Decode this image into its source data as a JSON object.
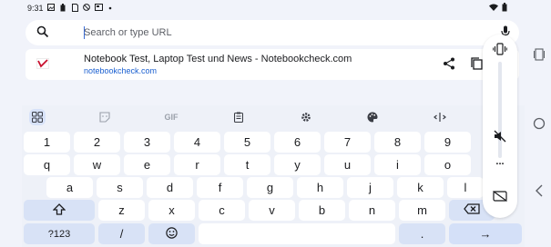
{
  "status_bar": {
    "time": "9:31",
    "left_icons": [
      "image-icon",
      "battery-saver-icon",
      "sim-icon",
      "dnd-icon",
      "screenshot-icon",
      "dot-icon"
    ],
    "right_icons": [
      "wifi-icon",
      "battery-icon"
    ]
  },
  "omnibox": {
    "placeholder": "Search or type URL",
    "value": ""
  },
  "suggestion": {
    "title": "Notebook Test, Laptop Test und News - Notebookcheck.com",
    "url": "notebookcheck.com",
    "accent": "#c8102e"
  },
  "keyboard": {
    "toolbar": {
      "gif_label": "GIF"
    },
    "rows": {
      "numbers": [
        "1",
        "2",
        "3",
        "4",
        "5",
        "6",
        "7",
        "8",
        "9"
      ],
      "row1": [
        "q",
        "w",
        "e",
        "r",
        "t",
        "y",
        "u",
        "i",
        "o"
      ],
      "row2": [
        "a",
        "s",
        "d",
        "f",
        "g",
        "h",
        "j",
        "k",
        "l"
      ],
      "row3": [
        "z",
        "x",
        "c",
        "v",
        "b",
        "n",
        "m"
      ]
    },
    "symbols_label": "?123",
    "slash_label": "/",
    "period_label": ".",
    "enter_symbol": "→"
  },
  "volume_panel": {
    "level": 0.0,
    "more_label": "..."
  },
  "colors": {
    "background": "#f1f3fa",
    "key": "#ffffff",
    "modifier_key": "#d8e2f6",
    "link": "#1a5fd0"
  }
}
